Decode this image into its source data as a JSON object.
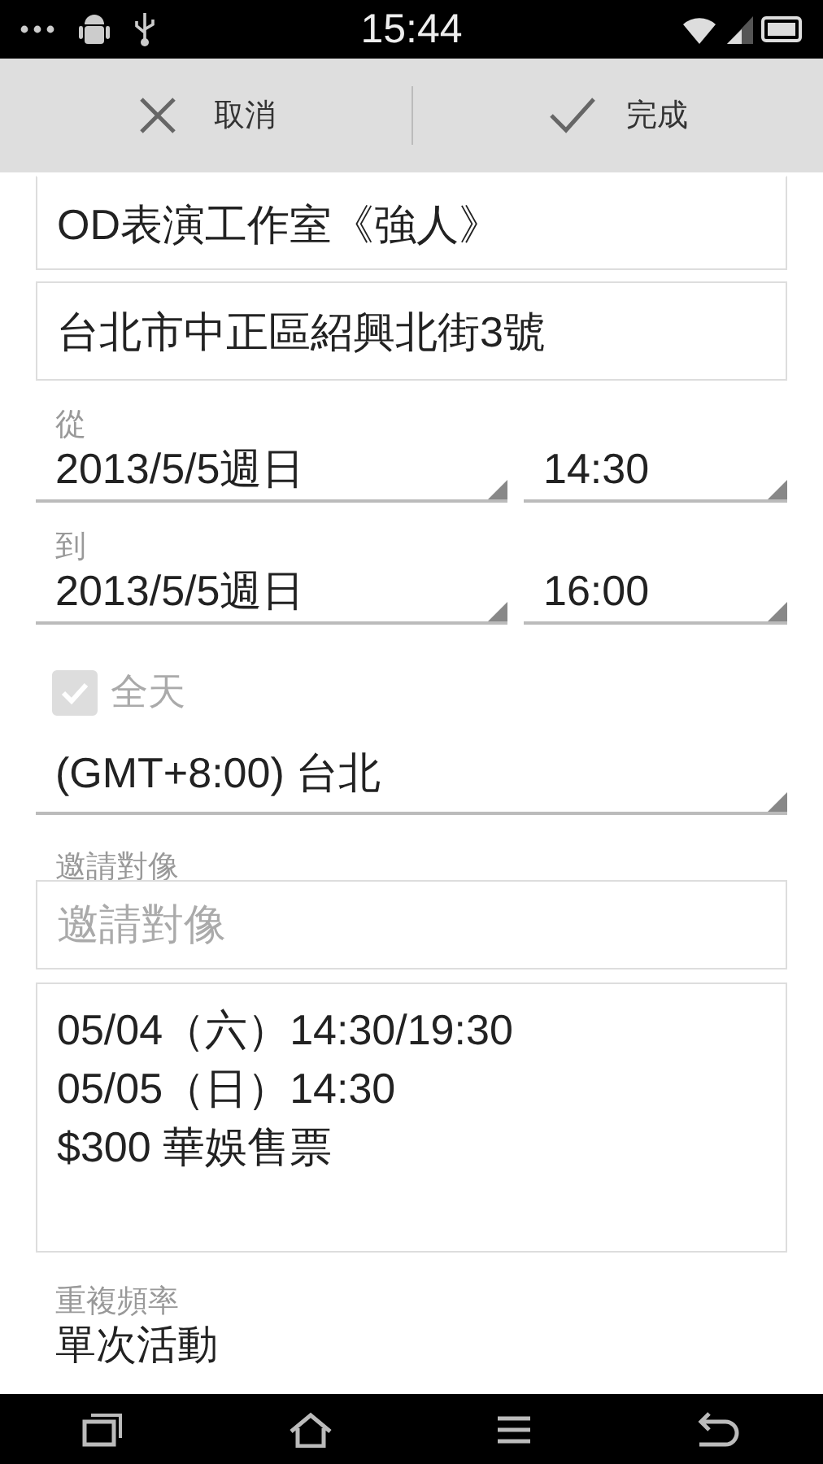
{
  "status_bar": {
    "time": "15:44"
  },
  "action_bar": {
    "buttons": [
      {
        "kind": "cancel",
        "label": "取消"
      },
      {
        "kind": "done",
        "label": "完成"
      }
    ]
  },
  "form": {
    "title": {
      "value": "OD表演工作室《強人》"
    },
    "location": {
      "value": "台北市中正區紹興北街3號"
    },
    "from": {
      "label": "從",
      "date": "2013/5/5週日",
      "time": "14:30"
    },
    "to": {
      "label": "到",
      "date": "2013/5/5週日",
      "time": "16:00"
    },
    "all_day": {
      "label": "全天",
      "checked": true,
      "disabled": true
    },
    "timezone": {
      "value": "(GMT+8:00) 台北"
    },
    "guests": {
      "label": "邀請對像",
      "placeholder": "邀請對像"
    },
    "description": {
      "value": "05/04（六）14:30/19:30\n05/05（日）14:30\n$300 華娛售票"
    },
    "repeat": {
      "label": "重複頻率",
      "value": "單次活動"
    }
  }
}
